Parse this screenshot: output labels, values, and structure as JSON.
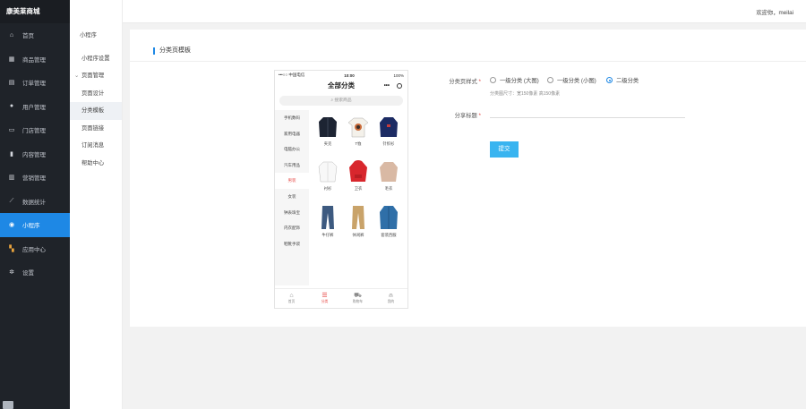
{
  "sidebar": {
    "brand": "康美莱商城",
    "items": [
      {
        "label": "首页",
        "icon": "home-icon"
      },
      {
        "label": "商品管理",
        "icon": "gift-icon"
      },
      {
        "label": "订单管理",
        "icon": "order-icon"
      },
      {
        "label": "用户管理",
        "icon": "user-icon"
      },
      {
        "label": "门店管理",
        "icon": "store-icon"
      },
      {
        "label": "内容管理",
        "icon": "document-icon"
      },
      {
        "label": "营销管理",
        "icon": "marketing-icon"
      },
      {
        "label": "数据统计",
        "icon": "chart-icon"
      },
      {
        "label": "小程序",
        "icon": "miniprogram-icon"
      },
      {
        "label": "应用中心",
        "icon": "apps-icon"
      },
      {
        "label": "设置",
        "icon": "gear-icon"
      }
    ]
  },
  "subnav": {
    "title": "小程序",
    "items": [
      "小程序设置",
      "页面管理",
      "页面设计",
      "分类模板",
      "页面链接",
      "订阅消息",
      "帮助中心"
    ]
  },
  "topbar": {
    "welcome": "欢迎你，meilai"
  },
  "card": {
    "title": "分类页模板"
  },
  "phone": {
    "carrier": "•••○○ 中国电信",
    "time": "10:00",
    "battery": "100%",
    "title": "全部分类",
    "search_placeholder": "搜索商品",
    "categories": [
      "手机数码",
      "家用电器",
      "电脑办公",
      "汽车用品",
      "男装",
      "女装",
      "钟表珠宝",
      "内衣配饰",
      "鞋靴手袋"
    ],
    "products": [
      "夹克",
      "T恤",
      "针织衫",
      "衬衫",
      "卫衣",
      "毛衣",
      "牛仔裤",
      "休闲裤",
      "套装西服"
    ],
    "tabs": [
      "首页",
      "分类",
      "购物车",
      "我的"
    ]
  },
  "form": {
    "style_label": "分类页样式",
    "options": [
      "一级分类 (大图)",
      "一级分类 (小图)",
      "二级分类"
    ],
    "hint": "分类图尺寸：宽150像素 高150像素",
    "share_label": "分享标题",
    "share_value": "",
    "submit_label": "提交"
  },
  "colors": {
    "accent": "#1e88e5",
    "submit": "#39b4f0",
    "sidebar": "#1f2329",
    "highlight": "#e64340"
  }
}
